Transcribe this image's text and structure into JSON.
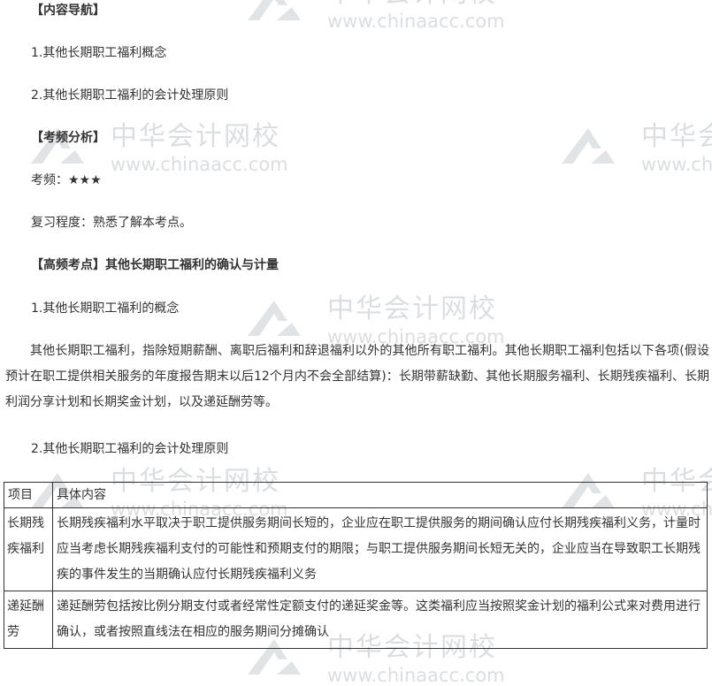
{
  "watermark": {
    "cn": "中华会计网校",
    "en": "www.chinaacc.com"
  },
  "nav": {
    "heading": "【内容导航】",
    "items": [
      "1.其他长期职工福利概念",
      "2.其他长期职工福利的会计处理原则"
    ]
  },
  "analysis": {
    "heading": "【考频分析】",
    "frequency": "考频：★★★",
    "level": "复习程度：熟悉了解本考点。"
  },
  "keypoint": {
    "heading": "【高频考点】其他长期职工福利的确认与计量",
    "sub1": "1.其他长期职工福利的概念",
    "para": "其他长期职工福利，指除短期薪酬、离职后福利和辞退福利以外的其他所有职工福利。其他长期职工福利包括以下各项(假设预计在职工提供相关服务的年度报告期末以后12个月内不会全部结算)：长期带薪缺勤、其他长期服务福利、长期残疾福利、长期利润分享计划和长期奖金计划，以及递延酬劳等。",
    "sub2": "2.其他长期职工福利的会计处理原则"
  },
  "table": {
    "headers": [
      "项目",
      "具体内容"
    ],
    "rows": [
      {
        "item": "长期残疾福利",
        "content": "长期残疾福利水平取决于职工提供服务期间长短的，企业应在职工提供服务的期间确认应付长期残疾福利义务，计量时应当考虑长期残疾福利支付的可能性和预期支付的期限；与职工提供服务期间长短无关的，企业应当在导致职工长期残疾的事件发生的当期确认应付长期残疾福利义务"
      },
      {
        "item": "递延酬劳",
        "content": "递延酬劳包括按比例分期支付或者经常性定额支付的递延奖金等。这类福利应当按照奖金计划的福利公式来对费用进行确认，或者按照直线法在相应的服务期间分摊确认"
      }
    ]
  }
}
